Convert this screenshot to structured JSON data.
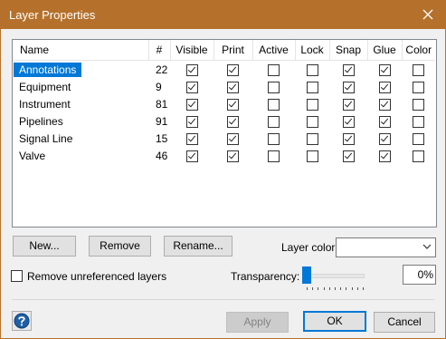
{
  "window": {
    "title": "Layer Properties"
  },
  "columns": [
    "Name",
    "#",
    "Visible",
    "Print",
    "Active",
    "Lock",
    "Snap",
    "Glue",
    "Color"
  ],
  "rows": [
    {
      "name": "Annotations",
      "count": "22",
      "selected": true,
      "flags": [
        true,
        true,
        false,
        false,
        true,
        true,
        false
      ]
    },
    {
      "name": "Equipment",
      "count": "9",
      "selected": false,
      "flags": [
        true,
        true,
        false,
        false,
        true,
        true,
        false
      ]
    },
    {
      "name": "Instrument",
      "count": "81",
      "selected": false,
      "flags": [
        true,
        true,
        false,
        false,
        true,
        true,
        false
      ]
    },
    {
      "name": "Pipelines",
      "count": "91",
      "selected": false,
      "flags": [
        true,
        true,
        false,
        false,
        true,
        true,
        false
      ]
    },
    {
      "name": "Signal Line",
      "count": "15",
      "selected": false,
      "flags": [
        true,
        true,
        false,
        false,
        true,
        true,
        false
      ]
    },
    {
      "name": "Valve",
      "count": "46",
      "selected": false,
      "flags": [
        true,
        true,
        false,
        false,
        true,
        true,
        false
      ]
    }
  ],
  "buttons": {
    "new": "New...",
    "remove": "Remove",
    "rename": "Rename...",
    "apply": "Apply",
    "ok": "OK",
    "cancel": "Cancel"
  },
  "layer_color": {
    "label": "Layer color:",
    "value": ""
  },
  "remove_unreferenced": {
    "label": "Remove unreferenced layers",
    "checked": false
  },
  "transparency": {
    "label": "Transparency:",
    "value": "0%",
    "level": 0
  },
  "icons": {
    "close": "close-icon",
    "help": "help-icon",
    "dropdown": "chevron-down-icon"
  },
  "colors": {
    "titlebar": "#b5712b",
    "selection": "#0078d7"
  }
}
